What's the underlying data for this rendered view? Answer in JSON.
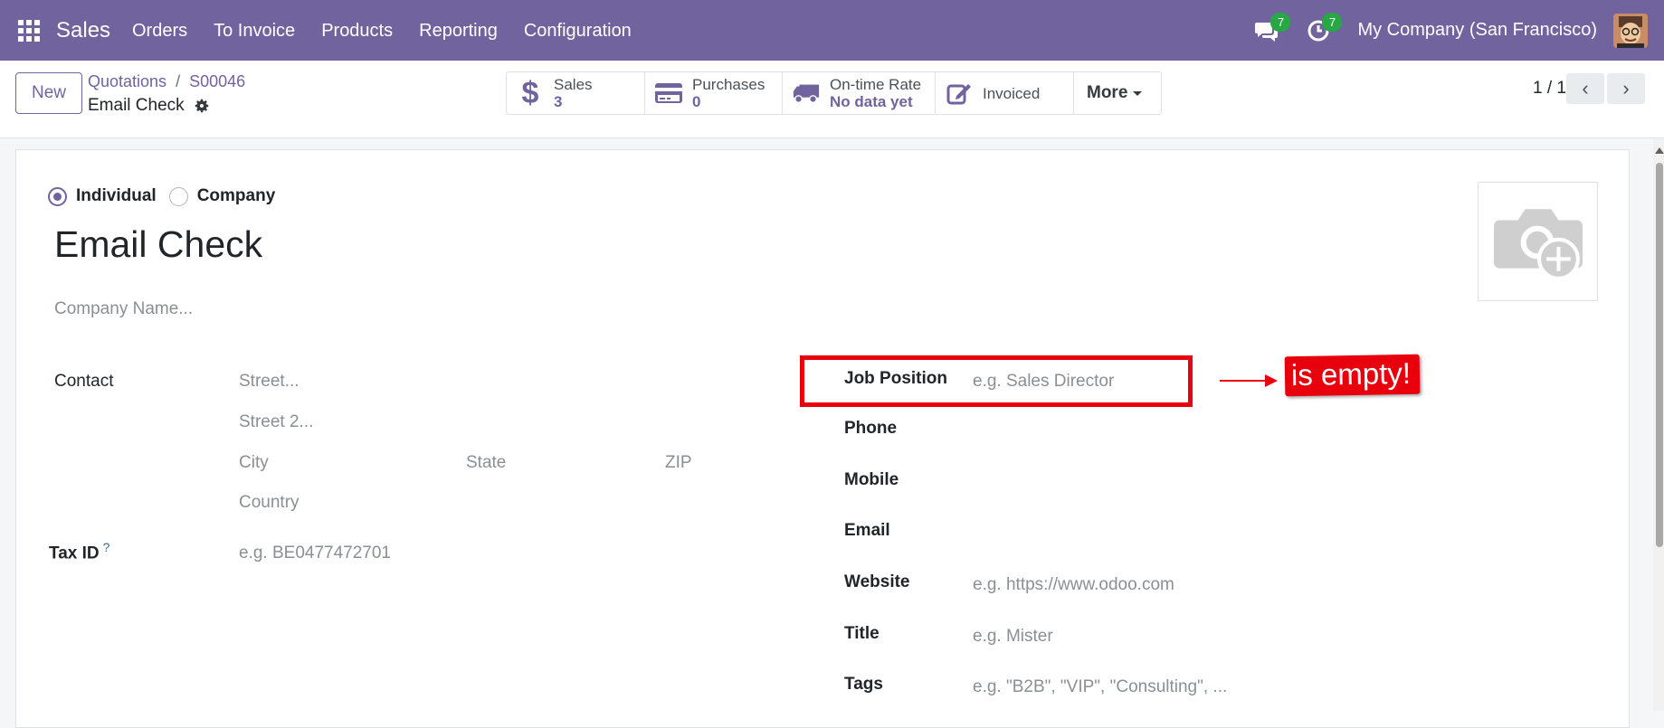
{
  "navbar": {
    "brand": "Sales",
    "menu": [
      "Orders",
      "To Invoice",
      "Products",
      "Reporting",
      "Configuration"
    ],
    "messages_badge": "7",
    "activities_badge": "7",
    "company": "My Company (San Francisco)"
  },
  "control": {
    "new_label": "New",
    "breadcrumb_root": "Quotations",
    "breadcrumb_sep": "/",
    "breadcrumb_parent": "S00046",
    "record_title": "Email Check",
    "smart_buttons": [
      {
        "label": "Sales",
        "value": "3",
        "icon": "dollar-icon"
      },
      {
        "label": "Purchases",
        "value": "0",
        "icon": "credit-card-icon"
      },
      {
        "label": "On-time Rate",
        "value": "No data yet",
        "icon": "truck-icon"
      },
      {
        "label": "Invoiced",
        "value": "",
        "icon": "edit-icon"
      },
      {
        "label": "More",
        "value": "",
        "icon": "caret-down-icon"
      }
    ],
    "pager": "1 / 1"
  },
  "form": {
    "type_individual": "Individual",
    "type_company": "Company",
    "selected_type": "Individual",
    "name": "Email Check",
    "company_placeholder": "Company Name...",
    "contact_label": "Contact",
    "street_ph": "Street...",
    "street2_ph": "Street 2...",
    "city_ph": "City",
    "state_ph": "State",
    "zip_ph": "ZIP",
    "country_ph": "Country",
    "tax_label": "Tax ID",
    "tax_help": "?",
    "tax_ph": "e.g. BE0477472701",
    "job_label": "Job Position",
    "job_ph": "e.g. Sales Director",
    "phone_label": "Phone",
    "mobile_label": "Mobile",
    "email_label": "Email",
    "website_label": "Website",
    "website_ph": "e.g. https://www.odoo.com",
    "title_label": "Title",
    "title_ph": "e.g. Mister",
    "tags_label": "Tags",
    "tags_ph": "e.g. \"B2B\", \"VIP\", \"Consulting\", ..."
  },
  "annotation": {
    "text": "is empty!",
    "color": "#e8000d"
  },
  "colors": {
    "brand": "#71639e",
    "badge": "#28a745"
  }
}
